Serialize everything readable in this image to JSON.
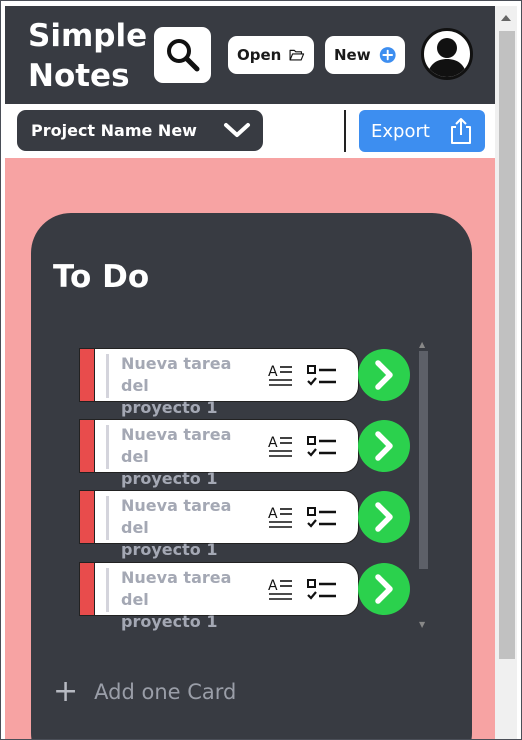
{
  "app": {
    "title_line1": "Simple",
    "title_line2": "Notes"
  },
  "header": {
    "search_icon": "search-icon",
    "open_label": "Open",
    "open_icon": "folder-open-icon",
    "new_label": "New",
    "new_icon": "plus-circle-icon",
    "avatar_icon": "user-avatar-icon"
  },
  "toolbar": {
    "project_name": "Project Name New",
    "project_dropdown_icon": "chevron-down-icon",
    "export_label": "Export",
    "export_icon": "share-icon"
  },
  "column": {
    "title": "To Do",
    "add_card_label": "Add one Card",
    "cards": [
      {
        "line1": "Nueva tarea del",
        "line2": "proyecto 1"
      },
      {
        "line1": "Nueva tarea del",
        "line2": "proyecto 1"
      },
      {
        "line1": "Nueva tarea del",
        "line2": "proyecto 1"
      },
      {
        "line1": "Nueva tarea del",
        "line2": "proyecto 1"
      }
    ]
  },
  "colors": {
    "header_bg": "#383b42",
    "board_bg": "#f7a3a3",
    "column_bg": "#383b42",
    "card_stripe": "#e84c4c",
    "go_button": "#2bd14d",
    "export_button": "#3d8ef0",
    "new_icon": "#3d8ef0"
  }
}
